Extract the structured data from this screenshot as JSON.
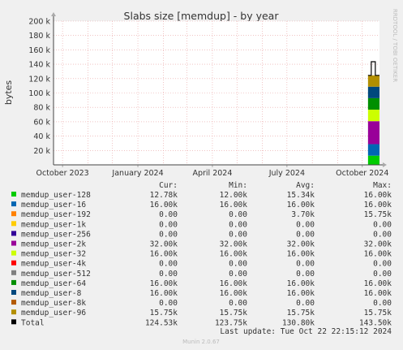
{
  "chart_data": {
    "type": "area",
    "title": "Slabs size [memdup] - by year",
    "ylabel": "bytes",
    "watermark": "RRDTOOL / TOBI OETIKER",
    "ylim": [
      0,
      200000
    ],
    "y_ticks": [
      {
        "value": 20000,
        "label": "20 k"
      },
      {
        "value": 40000,
        "label": "40 k"
      },
      {
        "value": 60000,
        "label": "60 k"
      },
      {
        "value": 80000,
        "label": "80 k"
      },
      {
        "value": 100000,
        "label": "100 k"
      },
      {
        "value": 120000,
        "label": "120 k"
      },
      {
        "value": 140000,
        "label": "140 k"
      },
      {
        "value": 160000,
        "label": "160 k"
      },
      {
        "value": 180000,
        "label": "180 k"
      },
      {
        "value": 200000,
        "label": "200 k"
      }
    ],
    "x_range": [
      "2023-09-20",
      "2024-10-22"
    ],
    "x_ticks": [
      {
        "date": "2023-10-01",
        "label": "October 2023"
      },
      {
        "date": "2024-01-01",
        "label": "January 2024"
      },
      {
        "date": "2024-04-01",
        "label": "April 2024"
      },
      {
        "date": "2024-07-01",
        "label": "July 2024"
      },
      {
        "date": "2024-10-01",
        "label": "October 2024"
      }
    ],
    "data_start": "2024-10-08",
    "grid": true,
    "legend_position": "bottom",
    "columns": [
      "Cur:",
      "Min:",
      "Avg:",
      "Max:"
    ],
    "series": [
      {
        "name": "memdup_user-128",
        "color": "#00cc00",
        "cur": "12.78k",
        "min": "12.00k",
        "avg": "15.34k",
        "max": "16.00k",
        "value": 12780
      },
      {
        "name": "memdup_user-16",
        "color": "#0066b3",
        "cur": "16.00k",
        "min": "16.00k",
        "avg": "16.00k",
        "max": "16.00k",
        "value": 16000
      },
      {
        "name": "memdup_user-192",
        "color": "#ff8000",
        "cur": "0.00",
        "min": "0.00",
        "avg": "3.70k",
        "max": "15.75k",
        "value": 0
      },
      {
        "name": "memdup_user-1k",
        "color": "#ffcc00",
        "cur": "0.00",
        "min": "0.00",
        "avg": "0.00",
        "max": "0.00",
        "value": 0
      },
      {
        "name": "memdup_user-256",
        "color": "#330099",
        "cur": "0.00",
        "min": "0.00",
        "avg": "0.00",
        "max": "0.00",
        "value": 0
      },
      {
        "name": "memdup_user-2k",
        "color": "#990099",
        "cur": "32.00k",
        "min": "32.00k",
        "avg": "32.00k",
        "max": "32.00k",
        "value": 32000
      },
      {
        "name": "memdup_user-32",
        "color": "#ccff00",
        "cur": "16.00k",
        "min": "16.00k",
        "avg": "16.00k",
        "max": "16.00k",
        "value": 16000
      },
      {
        "name": "memdup_user-4k",
        "color": "#ff0000",
        "cur": "0.00",
        "min": "0.00",
        "avg": "0.00",
        "max": "0.00",
        "value": 0
      },
      {
        "name": "memdup_user-512",
        "color": "#808080",
        "cur": "0.00",
        "min": "0.00",
        "avg": "0.00",
        "max": "0.00",
        "value": 0
      },
      {
        "name": "memdup_user-64",
        "color": "#008f00",
        "cur": "16.00k",
        "min": "16.00k",
        "avg": "16.00k",
        "max": "16.00k",
        "value": 16000
      },
      {
        "name": "memdup_user-8",
        "color": "#00487d",
        "cur": "16.00k",
        "min": "16.00k",
        "avg": "16.00k",
        "max": "16.00k",
        "value": 16000
      },
      {
        "name": "memdup_user-8k",
        "color": "#b35a00",
        "cur": "0.00",
        "min": "0.00",
        "avg": "0.00",
        "max": "0.00",
        "value": 0
      },
      {
        "name": "memdup_user-96",
        "color": "#b38f00",
        "cur": "15.75k",
        "min": "15.75k",
        "avg": "15.75k",
        "max": "15.75k",
        "value": 15750
      }
    ],
    "total": {
      "name": "Total",
      "color": "#000000",
      "cur": "124.53k",
      "min": "123.75k",
      "avg": "130.80k",
      "max": "143.50k",
      "peak": 143500
    },
    "last_update": "Last update: Tue Oct 22 22:15:12 2024",
    "footer": "Munin 2.0.67"
  }
}
